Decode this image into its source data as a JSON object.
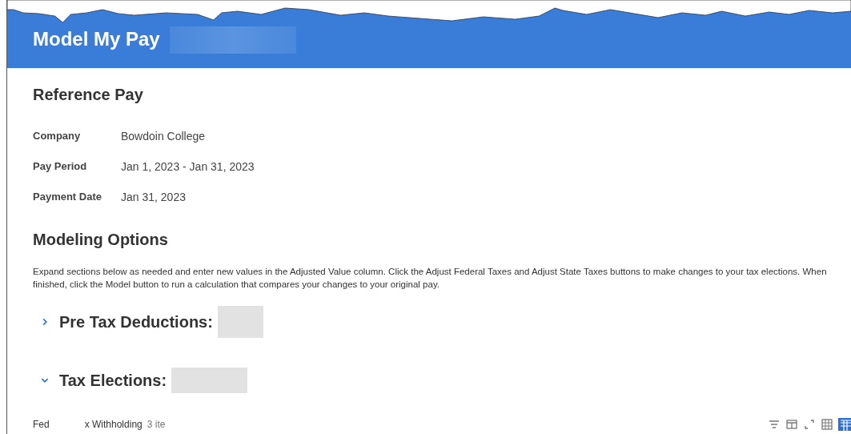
{
  "header": {
    "title": "Model My Pay"
  },
  "reference_pay": {
    "heading": "Reference Pay",
    "fields": [
      {
        "label": "Company",
        "value": "Bowdoin College"
      },
      {
        "label": "Pay Period",
        "value": "Jan 1, 2023 - Jan 31, 2023"
      },
      {
        "label": "Payment Date",
        "value": "Jan 31, 2023"
      }
    ]
  },
  "modeling_options": {
    "heading": "Modeling Options",
    "instructions": "Expand sections below as needed and enter new values in the Adjusted Value column. Click the Adjust Federal Taxes and Adjust State Taxes buttons to make changes to your tax elections. When finished, click the Model button to run a calculation that compares your changes to your original pay.",
    "sections": [
      {
        "title": "Pre Tax Deductions:",
        "expanded": false
      },
      {
        "title": "Tax Elections:",
        "expanded": true
      }
    ]
  },
  "table_bar": {
    "label_start": "Fed",
    "label_end": "x Withholding",
    "count": "3 ite"
  }
}
